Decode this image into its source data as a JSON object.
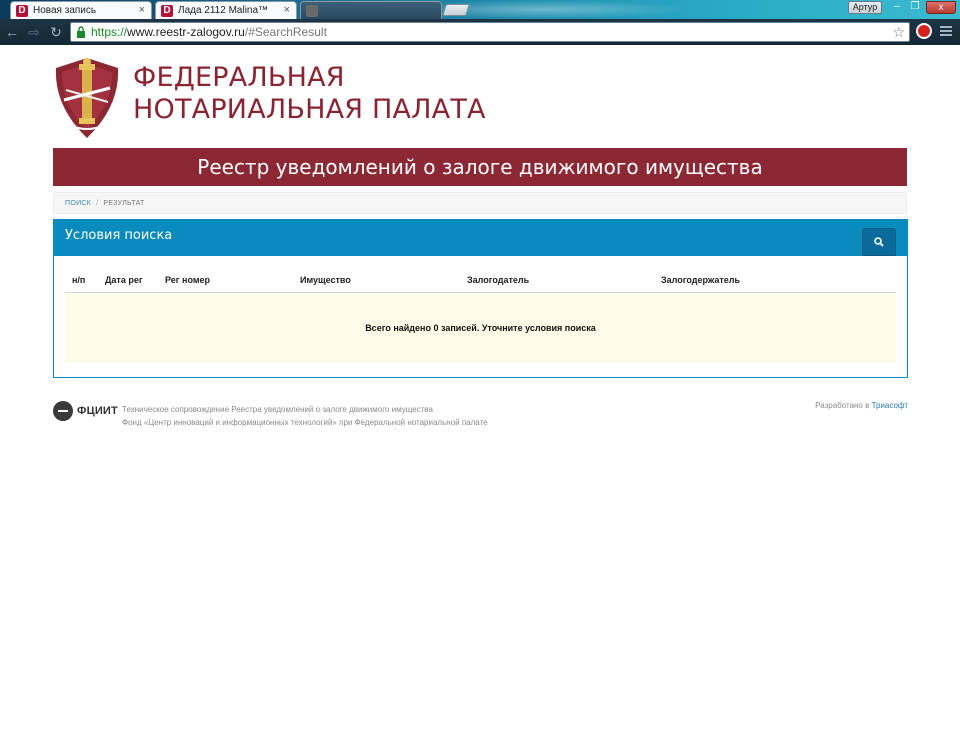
{
  "browser": {
    "tabs": [
      {
        "icon": "D",
        "title": "Новая запись"
      },
      {
        "icon": "D",
        "title": "Лада 2112 Malina™"
      },
      {
        "icon": "",
        "title": ""
      }
    ],
    "user_button": "Артур",
    "window_controls": {
      "minimize": "–",
      "maximize": "❐",
      "close": "x"
    },
    "url": {
      "scheme": "https://",
      "host": "www.reestr-zalogov.ru",
      "path": "/#SearchResult"
    }
  },
  "header": {
    "org_line1": "ФЕДЕРАЛЬНАЯ",
    "org_line2": "НОТАРИАЛЬНАЯ ПАЛАТА",
    "banner": "Реестр уведомлений о залоге движимого имущества"
  },
  "breadcrumb": {
    "items": [
      "ПОИСК",
      "РЕЗУЛЬТАТ"
    ]
  },
  "panel": {
    "title": "Условия поиска",
    "columns": [
      "н/п",
      "Дата рег",
      "Рег номер",
      "Имущество",
      "Залогодатель",
      "Залогодержатель"
    ],
    "empty_message": "Всего найдено 0 записей. Уточните условия поиска"
  },
  "footer": {
    "logo_text": "ФЦИИТ",
    "line1": "Техническое сопровождение Реестра уведомлений о залоге движимого имущества",
    "line2": "Фонд «Центр инноваций и информационных технологий» при Федеральной нотариальной палате",
    "dev_prefix": "Разработано в ",
    "dev_link": "Триасофт"
  },
  "colors": {
    "brand": "#8c2734",
    "panel": "#0a8bbd",
    "empty_row": "#fefde9"
  }
}
